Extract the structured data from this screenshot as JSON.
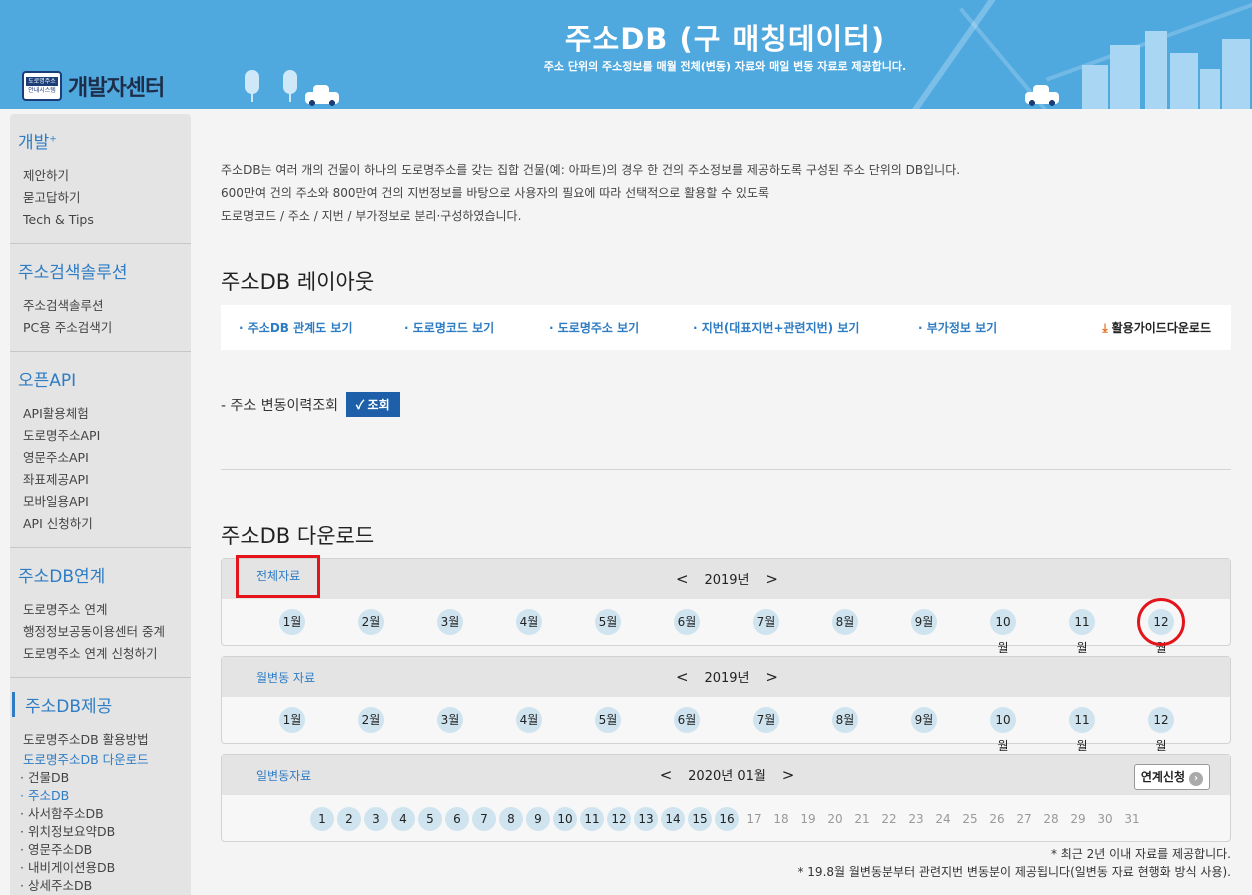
{
  "header": {
    "logo_badge_top": "도로명주소",
    "logo_badge_bottom": "안내시스템",
    "logo_text": "개발자센터",
    "title": "주소DB (구 매칭데이터)",
    "subtitle": "주소 단위의 주소정보를 매월 전체(변동) 자료와 매일 변동 자료로 제공합니다.",
    "bg_color": "#4fa9df"
  },
  "sidebar": {
    "sections": [
      {
        "title": "개발",
        "title_sup": "+",
        "items": [
          "제안하기",
          "묻고답하기",
          "Tech & Tips"
        ]
      },
      {
        "title": "주소검색솔루션",
        "items": [
          "주소검색솔루션",
          "PC용 주소검색기"
        ]
      },
      {
        "title": "오픈API",
        "items": [
          "API활용체험",
          "도로명주소API",
          "영문주소API",
          "좌표제공API",
          "모바일용API",
          "API 신청하기"
        ]
      },
      {
        "title": "주소DB연계",
        "items": [
          "도로명주소 연계",
          "행정정보공동이용센터 중계",
          "도로명주소 연계 신청하기"
        ]
      },
      {
        "title": "주소DB제공",
        "items": [
          "도로명주소DB 활용방법",
          "도로명주소DB 다운로드"
        ],
        "subitems": [
          "· 건물DB",
          "· 주소DB",
          "· 사서함주소DB",
          "· 위치정보요약DB",
          "· 영문주소DB",
          "· 내비게이션용DB",
          "· 상세주소DB"
        ]
      }
    ],
    "accent_color": "#2e7cc4"
  },
  "intro": {
    "line1": "주소DB는 여러 개의 건물이 하나의 도로명주소를 갖는 집합 건물(예: 아파트)의 경우 한 건의 주소정보를 제공하도록 구성된 주소 단위의 DB입니다.",
    "line2": "600만여 건의 주소와 800만여 건의 지번정보를 바탕으로 사용자의 필요에 따라 선택적으로 활용할 수 있도록",
    "line3": "도로명코드 / 주소 / 지번 / 부가정보로 분리·구성하였습니다."
  },
  "layout": {
    "heading": "주소DB 레이아웃",
    "links": [
      "· 주소DB 관계도 보기",
      "· 도로명코드 보기",
      "· 도로명주소 보기",
      "· 지번(대표지번+관련지번) 보기",
      "· 부가정보 보기"
    ],
    "guide": "활용가이드다운로드",
    "history_label": "- 주소 변동이력조회",
    "history_button": "✓ 조회"
  },
  "download": {
    "heading": "주소DB 다운로드",
    "full": {
      "label": "전체자료",
      "year": "2019년",
      "months": [
        "1월",
        "2월",
        "3월",
        "4월",
        "5월",
        "6월",
        "7월",
        "8월",
        "9월",
        "10월",
        "11월",
        "12월"
      ],
      "highlighted_month": "12월"
    },
    "monthly": {
      "label": "월변동 자료",
      "year": "2019년",
      "months": [
        "1월",
        "2월",
        "3월",
        "4월",
        "5월",
        "6월",
        "7월",
        "8월",
        "9월",
        "10월",
        "11월",
        "12월"
      ]
    },
    "daily": {
      "label": "일변동자료",
      "period": "2020년 01월",
      "button": "연계신청",
      "days": [
        "1",
        "2",
        "3",
        "4",
        "5",
        "6",
        "7",
        "8",
        "9",
        "10",
        "11",
        "12",
        "13",
        "14",
        "15",
        "16",
        "17",
        "18",
        "19",
        "20",
        "21",
        "22",
        "23",
        "24",
        "25",
        "26",
        "27",
        "28",
        "29",
        "30",
        "31"
      ],
      "available_through": 16
    },
    "prev_arrow": "<",
    "next_arrow": ">",
    "note1": "* 최근 2년 이내 자료를 제공합니다.",
    "note2": "* 19.8월 월변동분부터 관련지번 변동분이 제공됩니다(일변동 자료 현행화 방식 사용)."
  }
}
